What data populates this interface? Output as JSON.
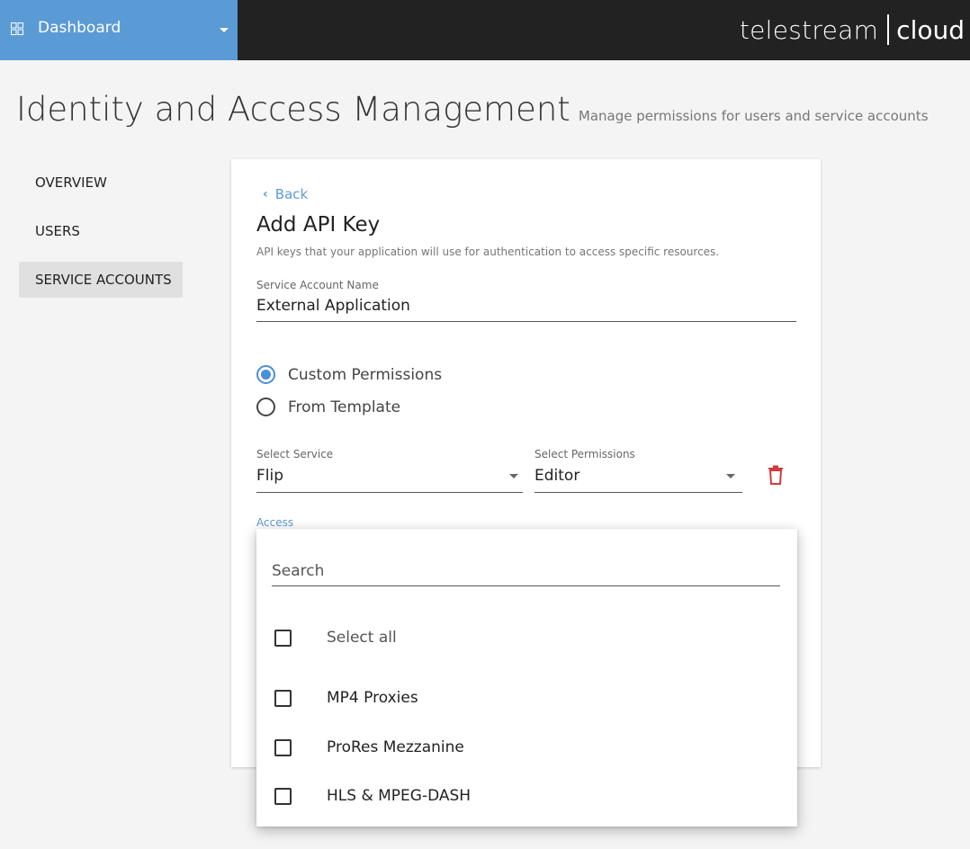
{
  "topbar": {
    "dashboard_label": "Dashboard",
    "brand_name": "telestream",
    "brand_product": "cloud"
  },
  "page": {
    "title": "Identity and Access Management",
    "subtitle": "Manage permissions for users and service accounts"
  },
  "nav": {
    "items": [
      {
        "label": "OVERVIEW"
      },
      {
        "label": "USERS"
      },
      {
        "label": "SERVICE ACCOUNTS",
        "active": true
      }
    ]
  },
  "card": {
    "back_label": "Back",
    "title": "Add API Key",
    "description": "API keys that your application will use for authentication to access specific resources.",
    "service_account": {
      "label": "Service Account Name",
      "value": "External Application"
    },
    "permission_mode": {
      "options": [
        {
          "label": "Custom Permissions",
          "selected": true
        },
        {
          "label": "From Template",
          "selected": false
        }
      ]
    },
    "select_service": {
      "label": "Select Service",
      "value": "Flip"
    },
    "select_permissions": {
      "label": "Select Permissions",
      "value": "Editor"
    },
    "access_label": "Access"
  },
  "dropdown": {
    "search_placeholder": "Search",
    "select_all_label": "Select all",
    "options": [
      {
        "label": "MP4 Proxies",
        "checked": false
      },
      {
        "label": "ProRes Mezzanine",
        "checked": false
      },
      {
        "label": "HLS & MPEG-DASH",
        "checked": false
      }
    ]
  },
  "colors": {
    "accent": "#5b9bd5",
    "topbar": "#222222",
    "danger": "#d23c3c",
    "nav_active_bg": "#e0e0e0"
  }
}
